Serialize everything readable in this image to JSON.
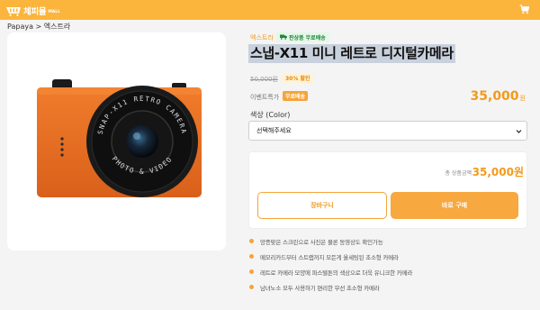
{
  "header": {
    "logo_text": "체피몰",
    "logo_sub": "MALL",
    "brand_color": "#fbb43c",
    "cart_icon": "cart-icon"
  },
  "breadcrumb": "Papaya > 엑스트라",
  "product": {
    "brand": "엑스트라",
    "shipping_badge": "판상품 무료배송",
    "title": "스냅-X11 미니 레트로 디지털카메라",
    "original_price": "50,000원",
    "discount": "30% 할인",
    "event_label": "이벤트특가",
    "free_badge": "무료배송",
    "price": "35,000",
    "price_unit": "원",
    "lens_text_top": "SNAP-X11 RETRO CAMERA",
    "lens_text_bottom": "PHOTO & VIDEO"
  },
  "options": {
    "color_label": "색상 (Color)",
    "select_placeholder": "선택해주세요"
  },
  "order": {
    "total_label": "총 상품금액",
    "total_value": "35,000원",
    "cart_button": "장바구니",
    "buy_button": "바로 구매"
  },
  "features": [
    "앙증맞은 스크린으로 사진은 물론 동영상도 확인가능",
    "메모리카드부터 스트랩까지 모든게 올세팅된 초소형 카메라",
    "레트로 카메라 모양에 파스텔톤의 색상으로 더욱 유니크한 카메라",
    "남녀노소 모두 사용하기 편리한 무선 초소형 카메라"
  ],
  "colors": {
    "accent": "#f29a1c",
    "button_fill": "#f7a83e",
    "camera_body": "#e86f23"
  }
}
